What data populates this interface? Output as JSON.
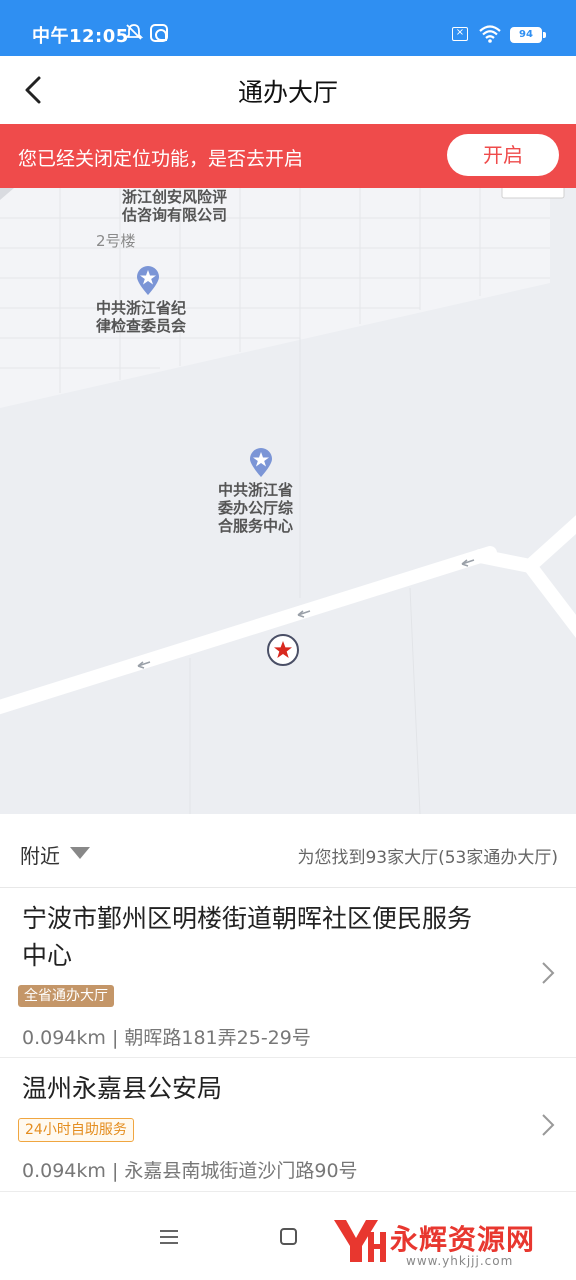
{
  "status_bar": {
    "time": "中午12:05",
    "battery": "94"
  },
  "header": {
    "title": "通办大厅"
  },
  "alert": {
    "message": "您已经关闭定位功能，是否去开启",
    "button_label": "开启"
  },
  "map": {
    "labels": {
      "company": [
        "浙江创安风险评",
        "估咨询有限公司"
      ],
      "building": "2号楼",
      "poi_1": [
        "中共浙江省纪",
        "律检查委员会"
      ],
      "poi_2": [
        "中共浙江省",
        "委办公厅综",
        "合服务中心"
      ]
    }
  },
  "filter": {
    "label": "附近",
    "summary": "为您找到93家大厅(53家通办大厅)"
  },
  "halls": [
    {
      "name_line1": "宁波市鄞州区明楼街道朝晖社区便民服务",
      "name_line2": "中心",
      "tag": "全省通办大厅",
      "address": "0.094km | 朝晖路181弄25-29号"
    },
    {
      "name_line1": "温州永嘉县公安局",
      "tag": "24小时自助服务",
      "address": "0.094km | 永嘉县南城街道沙门路90号"
    }
  ],
  "watermark": {
    "text": "永辉资源网",
    "url": "www.yhkjjj.com"
  },
  "colors": {
    "status_bar": "#2f8ff2",
    "alert": "#ef4b4b",
    "tag_province": "#c49668",
    "tag_24h": "#e48d1f"
  }
}
